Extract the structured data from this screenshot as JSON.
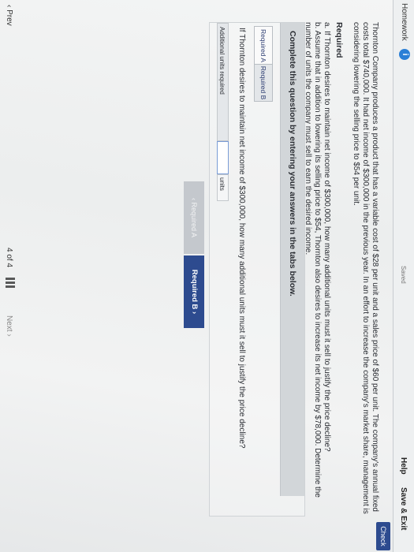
{
  "header": {
    "title": "Homework",
    "info_icon_glyph": "i",
    "status": "Saved",
    "help": "Help",
    "save_exit": "Save & Exit",
    "check": "Check"
  },
  "problem": {
    "text": "Thornton Company produces a product that has a variable cost of $28 per unit and a sales price of $60 per unit. The company's annual fixed costs total $740,000. It had net income of $300,000 in the previous year. In an effort to increase the company's market share, management is considering lowering the selling price to $54 per unit.",
    "required_heading": "Required",
    "required_items": [
      "a. If Thornton desires to maintain net income of $300,000, how many additional units must it sell to justify the price decline?",
      "b. Assume that in addition to lowering its selling price to $54, Thornton also desires to increase its net income by $78,000. Determine the number of units the company must sell to earn the desired income."
    ]
  },
  "instructions": "Complete this question by entering your answers in the tabs below.",
  "tabs": [
    {
      "label": "Required A",
      "active": true
    },
    {
      "label": "Required B",
      "active": false
    }
  ],
  "question": "If Thornton desires to maintain net income of $300,000, how many additional units must it sell to justify the price decline?",
  "answer_row": {
    "label": "Additional units required",
    "value": "",
    "units": "units"
  },
  "tab_nav": {
    "prev": "‹  Required A",
    "next": "Required B  ›"
  },
  "pager": {
    "prev": "‹ Prev",
    "position": "4 of 4",
    "next": "Next ›"
  },
  "colors": {
    "primary": "#2d4b8f",
    "info": "#2a7fd6",
    "disabled": "#c4c8cd"
  }
}
